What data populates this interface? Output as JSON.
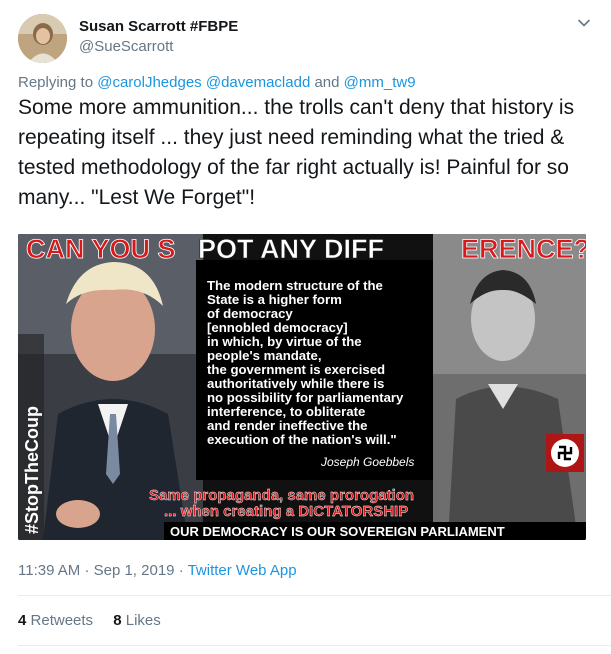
{
  "author": {
    "display_name": "Susan Scarrott #FBPE",
    "handle": "@SueScarrott"
  },
  "reply": {
    "prefix": "Replying to",
    "mention_1": "@carolJhedges",
    "mention_2": "@davemacladd",
    "joiner": "and",
    "mention_3": "@mm_tw9"
  },
  "tweet": {
    "text": "Some more ammunition... the trolls can't deny that history is repeating itself ... they just need reminding what the tried & tested methodology of the far right actually is! Painful for so many... \"Lest We Forget\"!"
  },
  "media": {
    "headline_red": "CAN YOU S",
    "headline_white": "POT ANY DIFF",
    "headline_red_2": "ERENCE?",
    "quote_lines": [
      "The modern structure of the",
      "State is a higher form",
      "of democracy",
      "[ennobled democracy]",
      "in which, by virtue of the",
      "people's mandate,",
      "the government is exercised",
      "authoritatively while there is",
      "no possibility for parliamentary",
      "interference, to obliterate",
      "and render ineffective the",
      "execution of the nation's will.\""
    ],
    "quote_author": "Joseph Goebbels",
    "side_hashtag": "#StopTheCoup",
    "propaganda_line_1": "Same propaganda, same prorogation",
    "propaganda_line_2": "... when creating a DICTATORSHIP",
    "bottom_banner": "OUR DEMOCRACY IS OUR SOVEREIGN PARLIAMENT"
  },
  "meta": {
    "time": "11:39 AM",
    "separator": "·",
    "date": "Sep 1, 2019",
    "source": "Twitter Web App"
  },
  "stats": {
    "retweets_count": "4",
    "retweets_label": "Retweets",
    "likes_count": "8",
    "likes_label": "Likes"
  },
  "colors": {
    "link": "#1b95e0",
    "secondary_text": "#657786",
    "primary_text": "#14171a",
    "headline_red": "#d7191c"
  }
}
